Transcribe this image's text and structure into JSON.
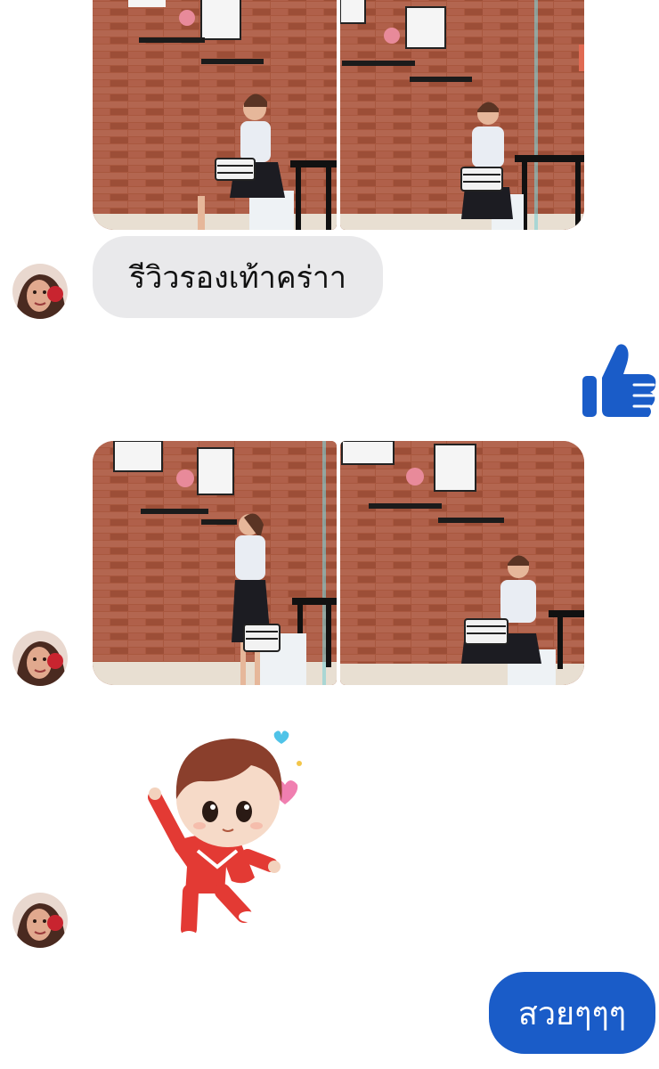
{
  "conversation": {
    "messages": [
      {
        "id": "m1",
        "sender": "contact",
        "type": "photo-group",
        "photo_count": 2
      },
      {
        "id": "m2",
        "sender": "contact",
        "type": "text",
        "text": "รีวิวรองเท้าคร่าา"
      },
      {
        "id": "m3",
        "sender": "me",
        "type": "like",
        "icon": "thumbs-up-icon"
      },
      {
        "id": "m4",
        "sender": "contact",
        "type": "photo-group",
        "photo_count": 2
      },
      {
        "id": "m5",
        "sender": "contact",
        "type": "sticker",
        "icon": "chibi-boy-sticker"
      },
      {
        "id": "m6",
        "sender": "me",
        "type": "text",
        "text": "สวยๆๆๆ"
      }
    ]
  },
  "colors": {
    "incoming_bubble": "#e9e9eb",
    "outgoing_bubble": "#1a5cc8",
    "like_icon": "#1a5cc8",
    "background": "#ffffff"
  }
}
